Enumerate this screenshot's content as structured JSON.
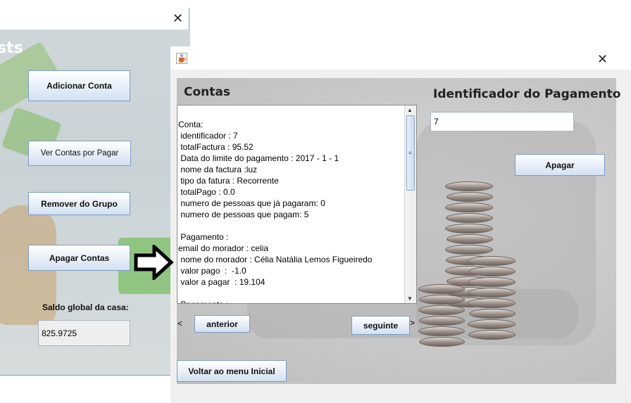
{
  "back_window": {
    "title_fragment": "sts",
    "close_glyph": "✕",
    "buttons": {
      "add_account": "Adicionar Conta",
      "view_unpaid": "Ver Contas por Pagar",
      "remove_group": "Remover do Grupo",
      "delete_accounts": "Apagar Contas"
    },
    "balance_label": "Saldo global da casa:",
    "balance_value": "825.9725"
  },
  "front_window": {
    "close_glyph": "✕",
    "heading": "Contas",
    "payment_id_label": "Identificador do Pagamento",
    "payment_id_value": "7",
    "delete_button": "Apagar",
    "text_area": "Conta:\n identificador : 7\n totalFactura : 95.52\n Data do limite do pagamento : 2017 - 1 - 1\n nome da factura :luz\n tipo da fatura : Recorrente\n totalPago : 0.0\n numero de pessoas que já pagaram: 0\n numero de pessoas que pagam: 5\n\n Pagamento :\nemail do morador : celia\n nome do morador : Célia Natália Lemos Figueiredo\n valor pago  :  -1.0\n valor a pagar  : 19.104\n\n Pagamento :",
    "prev_arrow": "<",
    "prev_button": "anterior",
    "next_button": "seguinte",
    "next_arrow": ">",
    "back_menu_button": "Voltar ao menu Inicial"
  },
  "colors": {
    "button_border": "#7a9cc4",
    "window_border": "#6b9fd8"
  },
  "icons": [
    "close-icon",
    "java-cup-icon",
    "arrow-right-icon",
    "scroll-up-icon",
    "scroll-down-icon"
  ]
}
